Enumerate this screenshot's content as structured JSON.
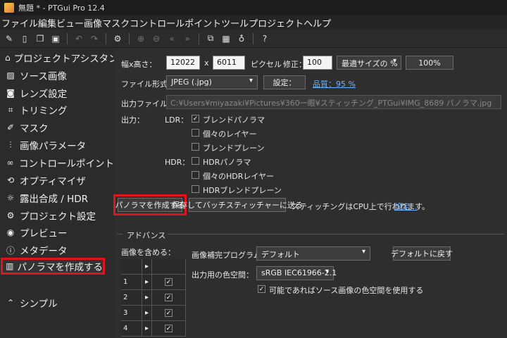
{
  "window": {
    "title": "無題 * - PTGui Pro 12.4"
  },
  "menu": [
    "ファイル",
    "編集",
    "ビュー",
    "画像",
    "マスク",
    "コントロールポイント",
    "ツール",
    "プロジェクト",
    "ヘルプ"
  ],
  "sidebar": {
    "items": [
      {
        "label": "プロジェクトアシスタント",
        "icon": "home-icon"
      },
      {
        "label": "ソース画像",
        "icon": "image-icon"
      },
      {
        "label": "レンズ設定",
        "icon": "camera-icon"
      },
      {
        "label": "トリミング",
        "icon": "crop-icon"
      },
      {
        "label": "マスク",
        "icon": "brush-icon"
      },
      {
        "label": "画像パラメータ",
        "icon": "sliders-icon"
      },
      {
        "label": "コントロールポイント",
        "icon": "control-points-icon"
      },
      {
        "label": "オプティマイザ",
        "icon": "optimizer-icon"
      },
      {
        "label": "露出合成 / HDR",
        "icon": "sun-icon"
      },
      {
        "label": "プロジェクト設定",
        "icon": "gear-icon"
      },
      {
        "label": "プレビュー",
        "icon": "eye-icon"
      },
      {
        "label": "メタデータ",
        "icon": "info-icon"
      },
      {
        "label": "パノラマを作成する",
        "icon": "panorama-icon"
      }
    ],
    "simple_label": "シンプル"
  },
  "size": {
    "label": "幅x高さ：",
    "width": "12022",
    "x": "x",
    "height": "6011",
    "unit": "ピクセル",
    "modify_label": "修正：",
    "modify_value": "100",
    "preset": "最適サイズの %",
    "percent_button": "100%"
  },
  "format": {
    "label": "ファイル形式：",
    "value": "JPEG (.jpg)",
    "settings_button": "設定：",
    "quality_link": "品質：95 %"
  },
  "output_file": {
    "label": "出力ファイル：",
    "value": "C:¥Users¥miyazaki¥Pictures¥360一眼¥スティッチング_PTGui¥IMG_8689 パノラマ.jpg"
  },
  "output": {
    "label": "出力：",
    "ldr_label": "LDR：",
    "ldr_options": [
      {
        "label": "ブレンドパノラマ",
        "checked": true
      },
      {
        "label": "個々のレイヤー",
        "checked": false
      },
      {
        "label": "ブレンドプレーン",
        "checked": false
      }
    ],
    "hdr_label": "HDR：",
    "hdr_options": [
      {
        "label": "HDRパノラマ",
        "checked": false
      },
      {
        "label": "個々のHDRレイヤー",
        "checked": false
      },
      {
        "label": "HDRブレンドプレーン",
        "checked": false
      }
    ]
  },
  "actions": {
    "create_button": "パノラマを作成する",
    "batch_button": "保存してバッチスティッチャーに送る",
    "stitch_text": "スティッチングはCPU上で行われます。",
    "settings_link": "設定..."
  },
  "advanced": {
    "title": "アドバンス",
    "include_label": "画像を含める：",
    "rows": [
      "1",
      "2",
      "3",
      "4"
    ],
    "interp_label": "画像補完プログラム：",
    "interp_value": "デフォルト",
    "reset_button": "デフォルトに戻す",
    "colorspace_label": "出力用の色空間：",
    "colorspace_value": "sRGB IEC61966-2.1",
    "source_colorspace_label": "可能であればソース画像の色空間を使用する"
  },
  "colors": {
    "highlight": "#e0141d",
    "link": "#6fb6ff"
  }
}
